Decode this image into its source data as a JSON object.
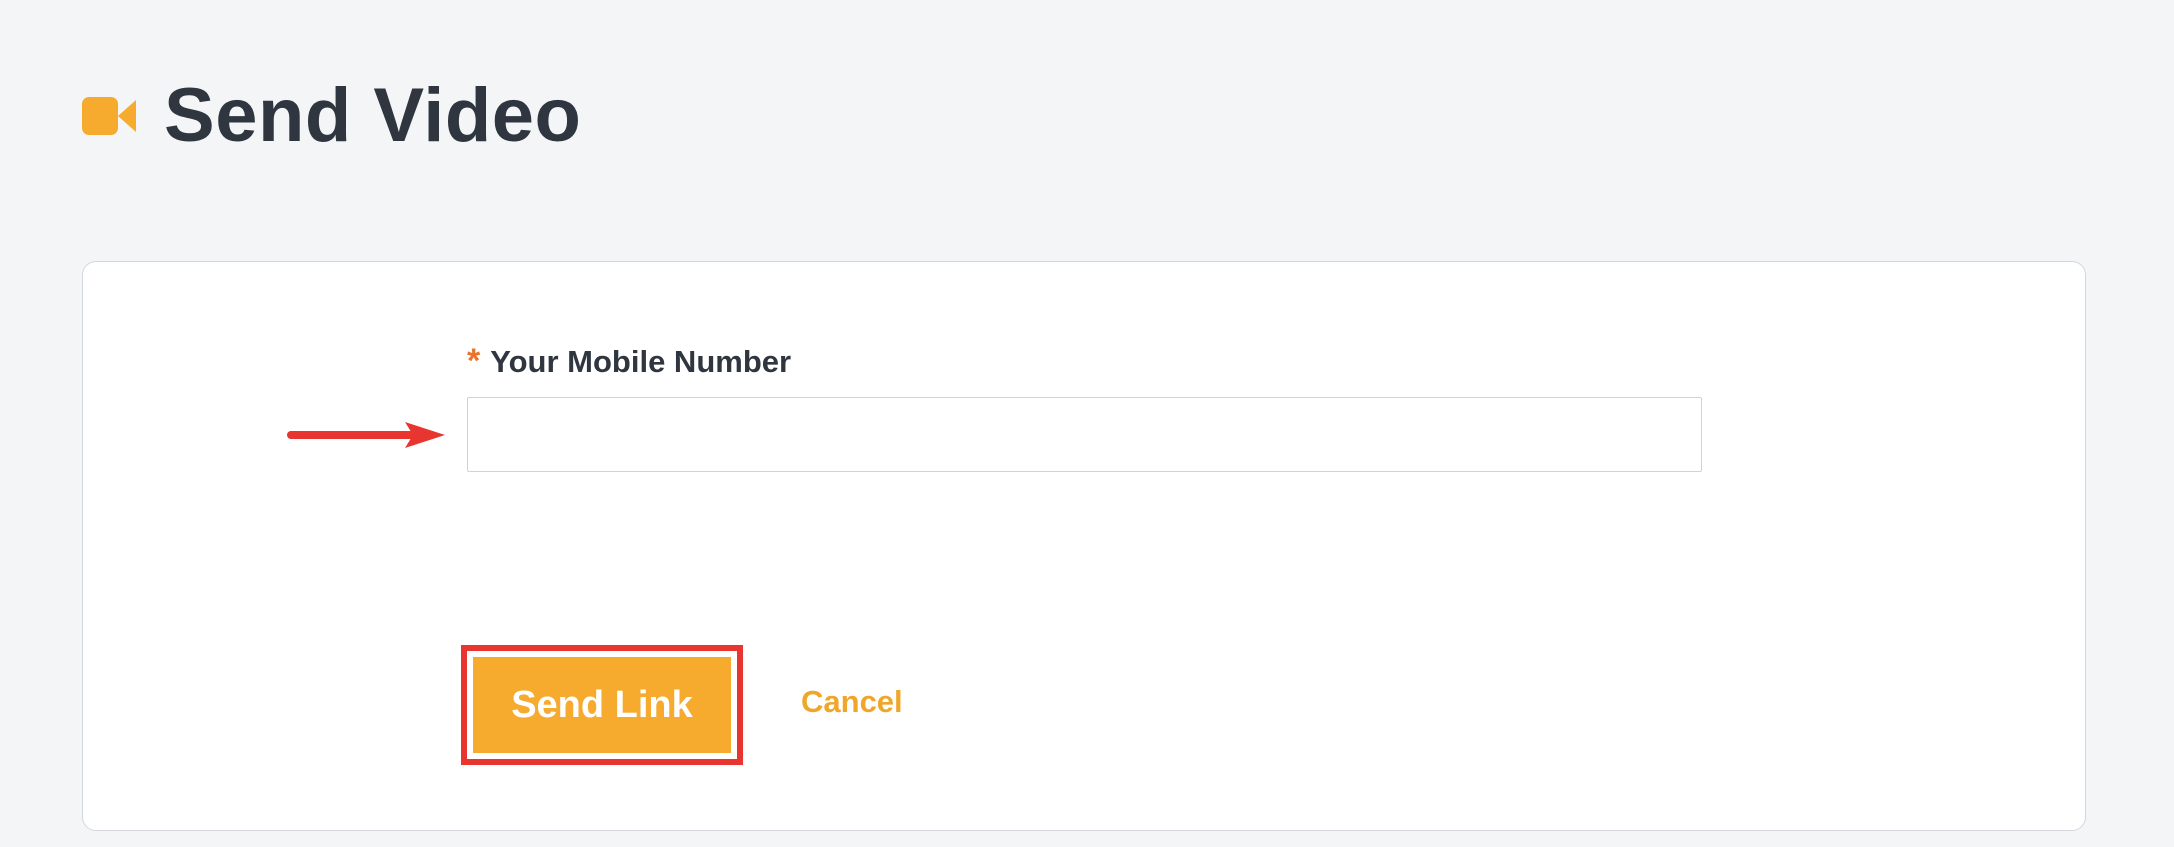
{
  "header": {
    "title": "Send Video",
    "icon": "video-camera-icon",
    "icon_color": "#f6ab2f"
  },
  "form": {
    "required_marker": "*",
    "mobile_label": "Your Mobile Number",
    "mobile_value": "",
    "send_label": "Send Link",
    "cancel_label": "Cancel"
  },
  "annotations": {
    "arrow_icon": "right-arrow-icon",
    "color": "#e8352f"
  },
  "colors": {
    "accent": "#f6ab2f",
    "required": "#e8742b",
    "background": "#f4f5f7"
  }
}
